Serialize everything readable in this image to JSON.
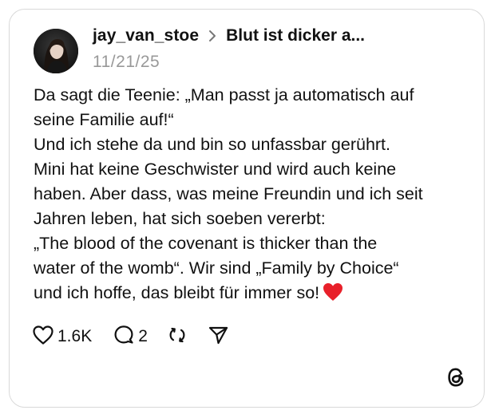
{
  "post": {
    "username": "jay_van_stoe",
    "topic": "Blut ist dicker a...",
    "timestamp": "11/21/25",
    "lines": [
      "Da sagt die Teenie: „Man passt ja automatisch auf",
      "seine Familie auf!“",
      "Und ich stehe da und bin so unfassbar gerührt.",
      "Mini hat keine Geschwister und wird auch keine",
      "haben. Aber dass, was meine Freundin und ich seit",
      "Jahren leben, hat sich soeben vererbt:",
      "„The blood of the covenant is thicker than the",
      "water of the womb“. Wir sind „Family by Choice“",
      "und ich hoffe, das bleibt für immer so!"
    ],
    "emoji": "red-heart-emoji"
  },
  "actions": {
    "like_count": "1.6K",
    "reply_count": "2"
  },
  "icons": {
    "like": "heart-icon",
    "reply": "speech-bubble-icon",
    "repost": "repost-icon",
    "share": "send-icon",
    "chevron": "chevron-right-icon",
    "brand": "threads-logo-icon"
  },
  "colors": {
    "text": "#111111",
    "muted": "#999999",
    "border": "#d9d9d9",
    "heart_emoji": "#e8202a"
  }
}
